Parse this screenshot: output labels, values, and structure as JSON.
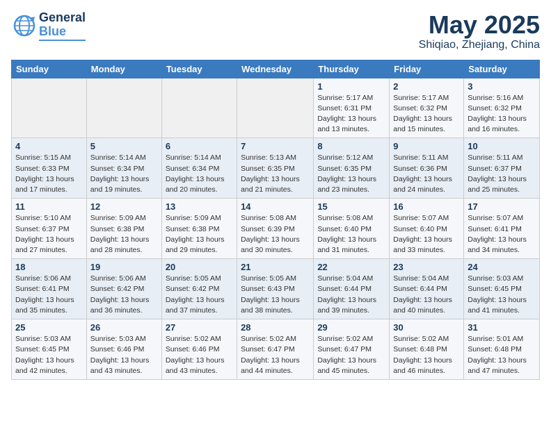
{
  "logo": {
    "part1": "General",
    "part2": "Blue"
  },
  "header": {
    "month": "May 2025",
    "location": "Shiqiao, Zhejiang, China"
  },
  "weekdays": [
    "Sunday",
    "Monday",
    "Tuesday",
    "Wednesday",
    "Thursday",
    "Friday",
    "Saturday"
  ],
  "weeks": [
    [
      {
        "day": "",
        "info": ""
      },
      {
        "day": "",
        "info": ""
      },
      {
        "day": "",
        "info": ""
      },
      {
        "day": "",
        "info": ""
      },
      {
        "day": "1",
        "info": "Sunrise: 5:17 AM\nSunset: 6:31 PM\nDaylight: 13 hours\nand 13 minutes."
      },
      {
        "day": "2",
        "info": "Sunrise: 5:17 AM\nSunset: 6:32 PM\nDaylight: 13 hours\nand 15 minutes."
      },
      {
        "day": "3",
        "info": "Sunrise: 5:16 AM\nSunset: 6:32 PM\nDaylight: 13 hours\nand 16 minutes."
      }
    ],
    [
      {
        "day": "4",
        "info": "Sunrise: 5:15 AM\nSunset: 6:33 PM\nDaylight: 13 hours\nand 17 minutes."
      },
      {
        "day": "5",
        "info": "Sunrise: 5:14 AM\nSunset: 6:34 PM\nDaylight: 13 hours\nand 19 minutes."
      },
      {
        "day": "6",
        "info": "Sunrise: 5:14 AM\nSunset: 6:34 PM\nDaylight: 13 hours\nand 20 minutes."
      },
      {
        "day": "7",
        "info": "Sunrise: 5:13 AM\nSunset: 6:35 PM\nDaylight: 13 hours\nand 21 minutes."
      },
      {
        "day": "8",
        "info": "Sunrise: 5:12 AM\nSunset: 6:35 PM\nDaylight: 13 hours\nand 23 minutes."
      },
      {
        "day": "9",
        "info": "Sunrise: 5:11 AM\nSunset: 6:36 PM\nDaylight: 13 hours\nand 24 minutes."
      },
      {
        "day": "10",
        "info": "Sunrise: 5:11 AM\nSunset: 6:37 PM\nDaylight: 13 hours\nand 25 minutes."
      }
    ],
    [
      {
        "day": "11",
        "info": "Sunrise: 5:10 AM\nSunset: 6:37 PM\nDaylight: 13 hours\nand 27 minutes."
      },
      {
        "day": "12",
        "info": "Sunrise: 5:09 AM\nSunset: 6:38 PM\nDaylight: 13 hours\nand 28 minutes."
      },
      {
        "day": "13",
        "info": "Sunrise: 5:09 AM\nSunset: 6:38 PM\nDaylight: 13 hours\nand 29 minutes."
      },
      {
        "day": "14",
        "info": "Sunrise: 5:08 AM\nSunset: 6:39 PM\nDaylight: 13 hours\nand 30 minutes."
      },
      {
        "day": "15",
        "info": "Sunrise: 5:08 AM\nSunset: 6:40 PM\nDaylight: 13 hours\nand 31 minutes."
      },
      {
        "day": "16",
        "info": "Sunrise: 5:07 AM\nSunset: 6:40 PM\nDaylight: 13 hours\nand 33 minutes."
      },
      {
        "day": "17",
        "info": "Sunrise: 5:07 AM\nSunset: 6:41 PM\nDaylight: 13 hours\nand 34 minutes."
      }
    ],
    [
      {
        "day": "18",
        "info": "Sunrise: 5:06 AM\nSunset: 6:41 PM\nDaylight: 13 hours\nand 35 minutes."
      },
      {
        "day": "19",
        "info": "Sunrise: 5:06 AM\nSunset: 6:42 PM\nDaylight: 13 hours\nand 36 minutes."
      },
      {
        "day": "20",
        "info": "Sunrise: 5:05 AM\nSunset: 6:42 PM\nDaylight: 13 hours\nand 37 minutes."
      },
      {
        "day": "21",
        "info": "Sunrise: 5:05 AM\nSunset: 6:43 PM\nDaylight: 13 hours\nand 38 minutes."
      },
      {
        "day": "22",
        "info": "Sunrise: 5:04 AM\nSunset: 6:44 PM\nDaylight: 13 hours\nand 39 minutes."
      },
      {
        "day": "23",
        "info": "Sunrise: 5:04 AM\nSunset: 6:44 PM\nDaylight: 13 hours\nand 40 minutes."
      },
      {
        "day": "24",
        "info": "Sunrise: 5:03 AM\nSunset: 6:45 PM\nDaylight: 13 hours\nand 41 minutes."
      }
    ],
    [
      {
        "day": "25",
        "info": "Sunrise: 5:03 AM\nSunset: 6:45 PM\nDaylight: 13 hours\nand 42 minutes."
      },
      {
        "day": "26",
        "info": "Sunrise: 5:03 AM\nSunset: 6:46 PM\nDaylight: 13 hours\nand 43 minutes."
      },
      {
        "day": "27",
        "info": "Sunrise: 5:02 AM\nSunset: 6:46 PM\nDaylight: 13 hours\nand 43 minutes."
      },
      {
        "day": "28",
        "info": "Sunrise: 5:02 AM\nSunset: 6:47 PM\nDaylight: 13 hours\nand 44 minutes."
      },
      {
        "day": "29",
        "info": "Sunrise: 5:02 AM\nSunset: 6:47 PM\nDaylight: 13 hours\nand 45 minutes."
      },
      {
        "day": "30",
        "info": "Sunrise: 5:02 AM\nSunset: 6:48 PM\nDaylight: 13 hours\nand 46 minutes."
      },
      {
        "day": "31",
        "info": "Sunrise: 5:01 AM\nSunset: 6:48 PM\nDaylight: 13 hours\nand 47 minutes."
      }
    ]
  ]
}
